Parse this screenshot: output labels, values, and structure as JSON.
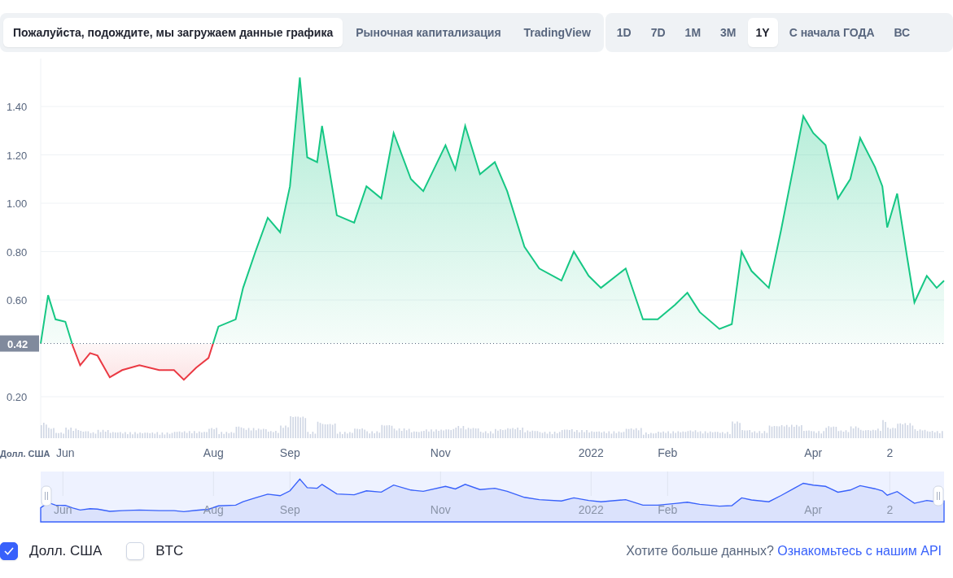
{
  "chart_tabs": [
    {
      "label": "Пожалуйста, подождите, мы загружаем данные графика",
      "selected": true
    },
    {
      "label": "Рыночная капитализация",
      "selected": false
    },
    {
      "label": "TradingView",
      "selected": false
    }
  ],
  "range_tabs": [
    {
      "label": "1D",
      "selected": false
    },
    {
      "label": "7D",
      "selected": false
    },
    {
      "label": "1M",
      "selected": false
    },
    {
      "label": "3M",
      "selected": false
    },
    {
      "label": "1Y",
      "selected": true
    },
    {
      "label": "С начала ГОДА",
      "selected": false
    },
    {
      "label": "ВС",
      "selected": false
    }
  ],
  "chart": {
    "chart_data": {
      "type": "area",
      "x": [
        "2021-05-23",
        "2021-05-26",
        "2021-05-29",
        "2021-06-02",
        "2021-06-05",
        "2021-06-08",
        "2021-06-12",
        "2021-06-15",
        "2021-06-20",
        "2021-06-25",
        "2021-07-02",
        "2021-07-10",
        "2021-07-16",
        "2021-07-20",
        "2021-07-25",
        "2021-07-30",
        "2021-08-03",
        "2021-08-10",
        "2021-08-13",
        "2021-08-18",
        "2021-08-23",
        "2021-08-28",
        "2021-09-01",
        "2021-09-05",
        "2021-09-08",
        "2021-09-12",
        "2021-09-14",
        "2021-09-20",
        "2021-09-27",
        "2021-10-02",
        "2021-10-08",
        "2021-10-13",
        "2021-10-20",
        "2021-10-25",
        "2021-11-03",
        "2021-11-07",
        "2021-11-11",
        "2021-11-17",
        "2021-11-23",
        "2021-11-28",
        "2021-12-05",
        "2021-12-11",
        "2021-12-20",
        "2021-12-25",
        "2021-12-31",
        "2022-01-05",
        "2022-01-15",
        "2022-01-22",
        "2022-01-28",
        "2022-02-04",
        "2022-02-09",
        "2022-02-14",
        "2022-02-22",
        "2022-02-27",
        "2022-03-03",
        "2022-03-07",
        "2022-03-14",
        "2022-03-19",
        "2022-03-24",
        "2022-03-28",
        "2022-04-01",
        "2022-04-06",
        "2022-04-11",
        "2022-04-16",
        "2022-04-20",
        "2022-04-26",
        "2022-04-29",
        "2022-05-01",
        "2022-05-05",
        "2022-05-09",
        "2022-05-12",
        "2022-05-17",
        "2022-05-21",
        "2022-05-24"
      ],
      "ylabel": "Долл. США",
      "series": [
        {
          "color": "#16c784",
          "values": [
            0.42,
            0.62,
            0.52,
            0.51,
            0.41,
            0.33,
            0.38,
            0.37,
            0.28,
            0.31,
            0.33,
            0.31,
            0.31,
            0.27,
            0.32,
            0.36,
            0.49,
            0.52,
            0.65,
            0.8,
            0.94,
            0.88,
            1.07,
            1.52,
            1.19,
            1.17,
            1.32,
            0.95,
            0.92,
            1.07,
            1.02,
            1.29,
            1.1,
            1.05,
            1.24,
            1.14,
            1.32,
            1.12,
            1.17,
            1.05,
            0.82,
            0.73,
            0.68,
            0.8,
            0.7,
            0.65,
            0.73,
            0.52,
            0.52,
            0.58,
            0.63,
            0.55,
            0.48,
            0.5,
            0.8,
            0.72,
            0.65,
            0.89,
            1.15,
            1.36,
            1.29,
            1.24,
            1.02,
            1.1,
            1.27,
            1.15,
            1.07,
            0.9,
            1.04,
            0.78,
            0.59,
            0.7,
            0.65,
            0.68
          ]
        }
      ],
      "ylim": [
        0,
        1.6
      ],
      "grid": true,
      "ref_lines": [
        {
          "axis": "y",
          "value": 0.42,
          "label": "0.42"
        }
      ],
      "xlim": [
        "2021-05-23",
        "2022-05-24"
      ],
      "yticks": [
        {
          "value": 0.2,
          "label": "0.20"
        },
        {
          "value": 0.6,
          "label": "0.60"
        },
        {
          "value": 0.8,
          "label": "0.80"
        },
        {
          "value": 1.0,
          "label": "1.00"
        },
        {
          "value": 1.2,
          "label": "1.20"
        },
        {
          "value": 1.4,
          "label": "1.40"
        }
      ],
      "xticks": [
        {
          "value": "2021-06-01",
          "label": "Jun"
        },
        {
          "value": "2021-08-01",
          "label": "Aug"
        },
        {
          "value": "2021-09-01",
          "label": "Sep"
        },
        {
          "value": "2021-11-01",
          "label": "Nov"
        },
        {
          "value": "2022-01-01",
          "label": "2022"
        },
        {
          "value": "2022-02-01",
          "label": "Feb"
        },
        {
          "value": "2022-04-01",
          "label": "Apr"
        },
        {
          "value": "2022-05-02",
          "label": "2"
        }
      ]
    }
  },
  "navigator": {
    "labels": [
      "Jun",
      "Aug",
      "Sep",
      "Nov",
      "2022",
      "Feb",
      "Apr",
      "2"
    ]
  },
  "currencies": [
    {
      "label": "Долл. США",
      "checked": true
    },
    {
      "label": "BTC",
      "checked": false
    }
  ],
  "api_prompt": {
    "text": "Хотите больше данных?",
    "link": "Ознакомьтесь с нашим API"
  }
}
